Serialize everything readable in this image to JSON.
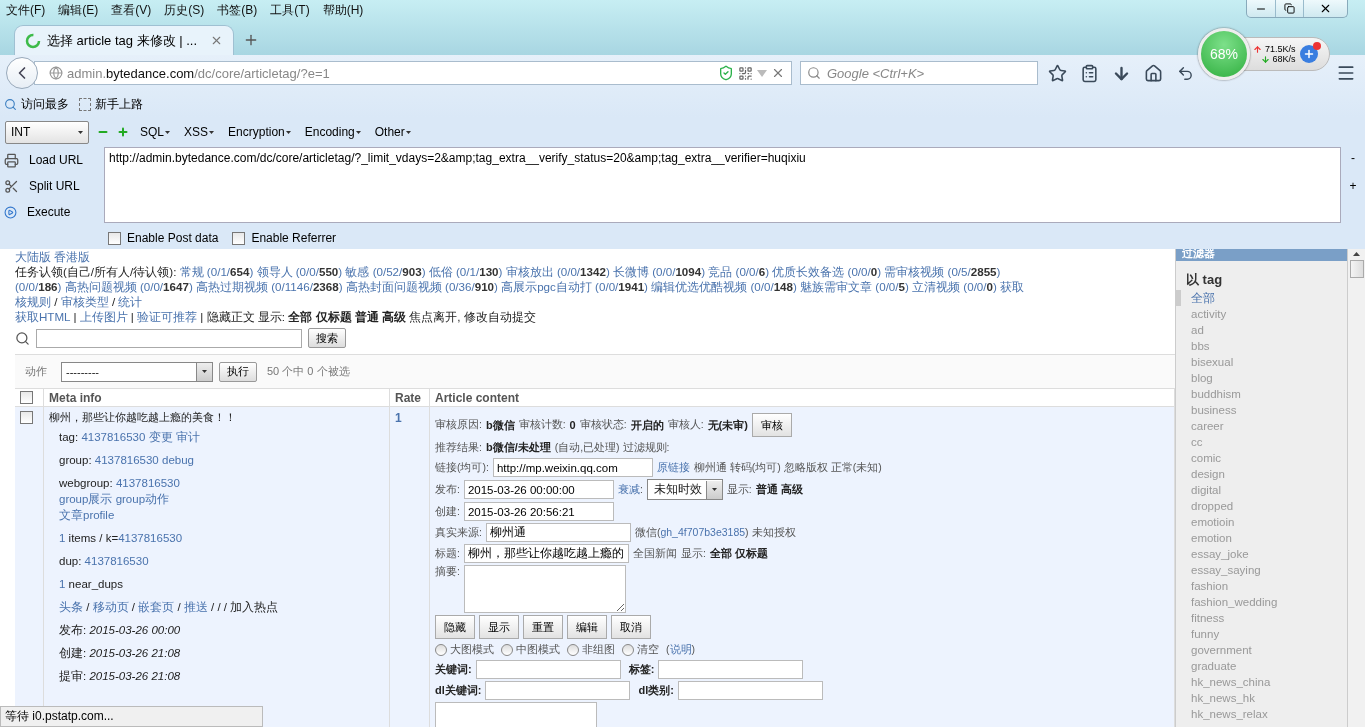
{
  "menu_bar": [
    "文件(F)",
    "编辑(E)",
    "查看(V)",
    "历史(S)",
    "书签(B)",
    "工具(T)",
    "帮助(H)"
  ],
  "tab": {
    "title": "选择 article tag 来修改 | ...",
    "selected": true
  },
  "address_bar": {
    "prefix": "admin.",
    "domain": "bytedance.com",
    "path": "/dc/core/articletag/?e=1"
  },
  "search": {
    "placeholder": "Google <Ctrl+K>"
  },
  "speed_widget": {
    "percent": "68%",
    "upload": "71.5K/s",
    "download": "68K/s"
  },
  "bookmarks": [
    "访问最多",
    "新手上路"
  ],
  "hackbar": {
    "select": "INT",
    "menus": [
      "SQL",
      "XSS",
      "Encryption",
      "Encoding",
      "Other"
    ],
    "actions": [
      "Load URL",
      "Split URL",
      "Execute"
    ],
    "url": "http://admin.bytedance.com/dc/core/articletag/?_limit_vdays=2&amp;tag_extra__verify_status=20&amp;tag_extra__verifier=huqixiu",
    "side": [
      "-",
      "+"
    ],
    "options": [
      {
        "label": "Enable Post data",
        "checked": false
      },
      {
        "label": "Enable Referrer",
        "checked": false
      }
    ]
  },
  "page": {
    "versions": [
      "大陆版",
      "香港版"
    ],
    "task_prefix": "任务认领(自己/所有人/待认领):",
    "task_lines": [
      [
        {
          "name": "常规",
          "count": "(0/1/**654**)"
        },
        {
          "name": "领导人",
          "count": "(0/0/**550**)"
        },
        {
          "name": "敏感",
          "count": "(0/52/**903**)"
        },
        {
          "name": "低俗",
          "count": "(0/1/**130**)"
        },
        {
          "name": "审核放出",
          "count": "(0/0/**1342**)"
        },
        {
          "name": "长微博",
          "count": "(0/0/**1094**)"
        },
        {
          "name": "竞品",
          "count": "(0/0/**6**)"
        },
        {
          "name": "优质长效备选",
          "count": "(0/0/**0**)"
        },
        {
          "name": "需审核视频",
          "count": "(0/5/**2855**)"
        }
      ],
      [
        {
          "count": "(0/0/**186**)"
        },
        {
          "name": "高热问题视频",
          "count": "(0/0/**1647**)"
        },
        {
          "name": "高热过期视频",
          "count": "(0/1146/**2368**)"
        },
        {
          "name": "高热封面问题视频",
          "count": "(0/36/**910**)"
        },
        {
          "name": "高展示pgc自动打",
          "count": "(0/0/**1941**)"
        },
        {
          "name": "编辑优选优酷视频",
          "count": "(0/0/**148**)"
        },
        {
          "name": "魅族需审文章",
          "count": "(0/0/**5**)"
        },
        {
          "name": "立清视频",
          "count": "(0/0/**0**)"
        },
        {
          "name": "获取"
        }
      ]
    ],
    "admin_links": [
      "核规则",
      "审核类型",
      "统计"
    ],
    "admin_separator": "/",
    "tools": {
      "separator": "|",
      "links": [
        "获取HTML",
        "上传图片",
        "验证可推荐"
      ],
      "hide": "隐藏正文",
      "display_label": "显示:",
      "display_options": [
        "全部",
        "仅标题",
        "普通",
        "高级"
      ],
      "note": "焦点离开, 修改自动提交"
    },
    "search_button": "搜索",
    "actions": {
      "label": "动作",
      "select": "---------",
      "button": "执行",
      "count": "50 个中 0 个被选"
    }
  },
  "table": {
    "columns": [
      {
        "kind": "checkbox",
        "checked": false
      },
      {
        "kind": "text",
        "label": "Meta info"
      },
      {
        "kind": "text",
        "label": "Rate"
      },
      {
        "kind": "text",
        "label": "Article content"
      }
    ],
    "rows": [
      {
        "checked": false,
        "title": "柳州，那些让你越吃越上瘾的美食！！",
        "rate": "1",
        "meta": [
          [
            [
              {
                "kind": "label",
                "text": "tag:"
              },
              {
                "kind": "link",
                "text": "4137816530"
              },
              {
                "kind": "link",
                "text": "变更"
              },
              {
                "kind": "link",
                "text": "审计"
              }
            ]
          ],
          [
            [
              {
                "kind": "label",
                "text": "group:"
              },
              {
                "kind": "link",
                "text": "4137816530"
              },
              {
                "kind": "link",
                "text": "debug"
              }
            ]
          ],
          [
            [
              {
                "kind": "label",
                "text": "webgroup:"
              },
              {
                "kind": "link",
                "text": "4137816530"
              }
            ],
            [
              {
                "kind": "link",
                "text": "group展示"
              },
              {
                "kind": "link",
                "text": "group动作"
              }
            ],
            [
              {
                "kind": "link",
                "text": "文章profile"
              }
            ]
          ],
          [
            [
              {
                "kind": "link",
                "text": "1"
              },
              {
                "kind": "text",
                "text": "items / k="
              },
              {
                "kind": "link",
                "text": "4137816530",
                "tight": true
              }
            ]
          ],
          [
            [
              {
                "kind": "label",
                "text": "dup:"
              },
              {
                "kind": "link",
                "text": "4137816530"
              }
            ]
          ],
          [
            [
              {
                "kind": "link",
                "text": "1"
              },
              {
                "kind": "text",
                "text": "near_dups"
              }
            ]
          ],
          [
            [
              {
                "kind": "link",
                "text": "头条"
              },
              {
                "kind": "text",
                "text": "/"
              },
              {
                "kind": "link",
                "text": "移动页"
              },
              {
                "kind": "text",
                "text": "/"
              },
              {
                "kind": "link",
                "text": "嵌套页"
              },
              {
                "kind": "text",
                "text": "/"
              },
              {
                "kind": "link",
                "text": "推送"
              },
              {
                "kind": "text",
                "text": "/ / /"
              },
              {
                "kind": "text",
                "text": "加入热点"
              }
            ]
          ],
          [
            [
              {
                "kind": "label",
                "text": "发布:"
              },
              {
                "kind": "date",
                "text": "2015-03-26 00:00"
              }
            ]
          ],
          [
            [
              {
                "kind": "label",
                "text": "创建:"
              },
              {
                "kind": "date",
                "text": "2015-03-26 21:08"
              }
            ]
          ],
          [
            [
              {
                "kind": "label",
                "text": "提审:"
              },
              {
                "kind": "date",
                "text": "2015-03-26 21:08"
              }
            ]
          ]
        ],
        "content": {
          "review": [
            {
              "label": "审核原因:",
              "value": "b微信"
            },
            {
              "label": "审核计数:",
              "value": "0"
            },
            {
              "label": "审核状态:",
              "value": "开启的"
            },
            {
              "label": "审核人:",
              "value": "无(未审)"
            }
          ],
          "review_button": "审核",
          "recommend": {
            "label": "推荐结果:",
            "value": "b微信/未处理",
            "note": "(自动,已处理) 过滤规则:"
          },
          "link": {
            "label": "链接(均可):",
            "value": "http://mp.weixin.qq.com",
            "source_link": "原链接",
            "extras": "柳州通 转码(均可) 忽略版权 正常(未知)"
          },
          "publish": {
            "label": "发布:",
            "value": "2015-03-26 00:00:00",
            "decay_link": "衰减",
            "decay_suffix": ":",
            "decay_select": "未知时效",
            "display_label": "显示:",
            "display_value": "普通 高级"
          },
          "created": {
            "label": "创建:",
            "value": "2015-03-26 20:56:21"
          },
          "source": {
            "label": "真实来源:",
            "value": "柳州通",
            "wechat_prefix": "微信(",
            "wechat_id": "gh_4f707b3e3185",
            "wechat_suffix": ") 未知授权"
          },
          "title": {
            "label": "标题:",
            "value": "柳州，那些让你越吃越上瘾的",
            "category": "全国新闻",
            "display_label": "显示:",
            "display_value": "全部 仅标题"
          },
          "summary": {
            "label": "摘要:"
          },
          "buttons": [
            "隐藏",
            "显示",
            "重置",
            "编辑",
            "取消"
          ],
          "modes": [
            {
              "label": "大图模式",
              "selected": false
            },
            {
              "label": "中图模式",
              "selected": false
            },
            {
              "label": "非组图",
              "selected": false
            },
            {
              "label": "清空",
              "selected": false
            }
          ],
          "help": {
            "before": "(",
            "link": "说明",
            "after": ")"
          },
          "keywords": [
            {
              "label": "关键词:"
            },
            {
              "label": "标签:"
            }
          ],
          "dl_fields": [
            {
              "label": "dl关键词:"
            },
            {
              "label": "dl类别:"
            }
          ]
        }
      }
    ]
  },
  "sidebar": {
    "title": "过滤器",
    "section": "以 tag",
    "items": [
      {
        "label": "全部",
        "selected": true
      },
      {
        "label": "activity",
        "selected": false
      },
      {
        "label": "ad",
        "selected": false
      },
      {
        "label": "bbs",
        "selected": false
      },
      {
        "label": "bisexual",
        "selected": false
      },
      {
        "label": "blog",
        "selected": false
      },
      {
        "label": "buddhism",
        "selected": false
      },
      {
        "label": "business",
        "selected": false
      },
      {
        "label": "career",
        "selected": false
      },
      {
        "label": "cc",
        "selected": false
      },
      {
        "label": "comic",
        "selected": false
      },
      {
        "label": "design",
        "selected": false
      },
      {
        "label": "digital",
        "selected": false
      },
      {
        "label": "dropped",
        "selected": false
      },
      {
        "label": "emotioin",
        "selected": false
      },
      {
        "label": "emotion",
        "selected": false
      },
      {
        "label": "essay_joke",
        "selected": false
      },
      {
        "label": "essay_saying",
        "selected": false
      },
      {
        "label": "fashion",
        "selected": false
      },
      {
        "label": "fashion_wedding",
        "selected": false
      },
      {
        "label": "fitness",
        "selected": false
      },
      {
        "label": "funny",
        "selected": false
      },
      {
        "label": "government",
        "selected": false
      },
      {
        "label": "graduate",
        "selected": false
      },
      {
        "label": "hk_news_china",
        "selected": false
      },
      {
        "label": "hk_news_hk",
        "selected": false
      },
      {
        "label": "hk_news_relax",
        "selected": false
      }
    ]
  },
  "status_bar": {
    "text": "等待 i0.pstatp.com..."
  }
}
